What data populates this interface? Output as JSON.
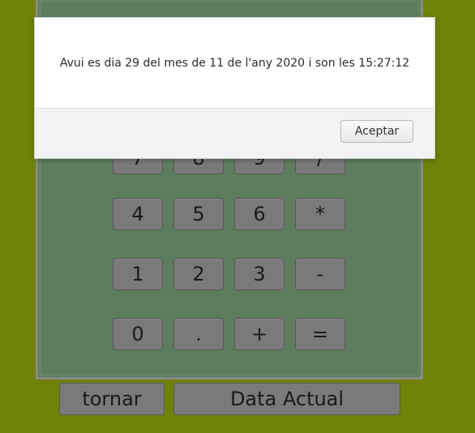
{
  "colors": {
    "background": "#70820a",
    "panel": "#5e7c5e",
    "key": "#7a7a7a"
  },
  "keypad": {
    "row_top": [
      "7",
      "8",
      "9",
      "/"
    ],
    "row1": [
      "4",
      "5",
      "6",
      "*"
    ],
    "row2": [
      "1",
      "2",
      "3",
      "-"
    ],
    "row3": [
      "0",
      ".",
      "+",
      "="
    ]
  },
  "bottom": {
    "back_label": "tornar",
    "date_label": "Data Actual"
  },
  "dialog": {
    "message": "Avui es dia 29 del mes de 11 de l'any 2020 i son les 15:27:12",
    "accept_label": "Aceptar"
  }
}
